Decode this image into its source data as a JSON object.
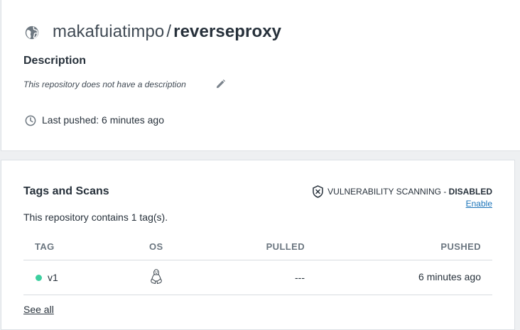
{
  "repo": {
    "owner": "makafuiatimpo",
    "separator": "/",
    "name": "reverseproxy"
  },
  "description": {
    "heading": "Description",
    "text": "This repository does not have a description"
  },
  "last_pushed": {
    "text": "Last pushed: 6 minutes ago"
  },
  "tags": {
    "heading": "Tags and Scans",
    "vulnerability_label": "VULNERABILITY SCANNING - ",
    "vulnerability_status": "DISABLED",
    "enable_link": "Enable",
    "contains_text": "This repository contains 1 tag(s).",
    "columns": {
      "tag": "TAG",
      "os": "OS",
      "pulled": "PULLED",
      "pushed": "PUSHED"
    },
    "rows": [
      {
        "tag": "v1",
        "os_icon": "linux-icon",
        "pulled": "---",
        "pushed": "6 minutes ago",
        "status_color": "#3dcf9f"
      }
    ],
    "see_all": "See all"
  },
  "colors": {
    "accent_link": "#1a73b9",
    "text": "#27313b",
    "muted": "#6b7680"
  }
}
